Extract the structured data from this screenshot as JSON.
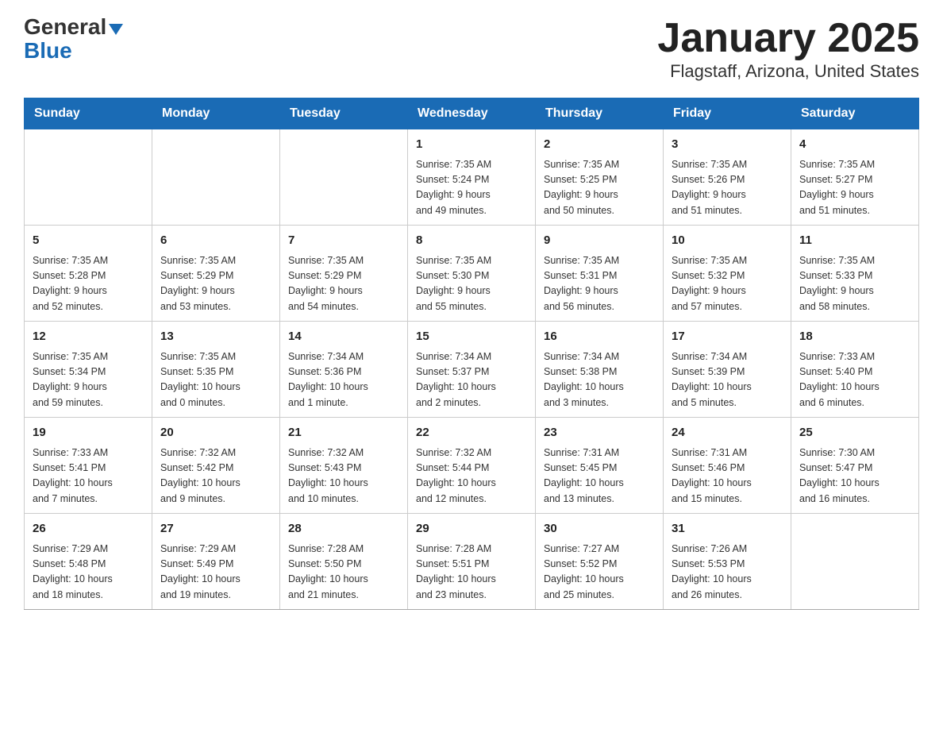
{
  "header": {
    "logo_general": "General",
    "logo_arrow": "▼",
    "logo_blue": "Blue",
    "title": "January 2025",
    "subtitle": "Flagstaff, Arizona, United States"
  },
  "calendar": {
    "days_of_week": [
      "Sunday",
      "Monday",
      "Tuesday",
      "Wednesday",
      "Thursday",
      "Friday",
      "Saturday"
    ],
    "weeks": [
      [
        {
          "day": "",
          "info": ""
        },
        {
          "day": "",
          "info": ""
        },
        {
          "day": "",
          "info": ""
        },
        {
          "day": "1",
          "info": "Sunrise: 7:35 AM\nSunset: 5:24 PM\nDaylight: 9 hours\nand 49 minutes."
        },
        {
          "day": "2",
          "info": "Sunrise: 7:35 AM\nSunset: 5:25 PM\nDaylight: 9 hours\nand 50 minutes."
        },
        {
          "day": "3",
          "info": "Sunrise: 7:35 AM\nSunset: 5:26 PM\nDaylight: 9 hours\nand 51 minutes."
        },
        {
          "day": "4",
          "info": "Sunrise: 7:35 AM\nSunset: 5:27 PM\nDaylight: 9 hours\nand 51 minutes."
        }
      ],
      [
        {
          "day": "5",
          "info": "Sunrise: 7:35 AM\nSunset: 5:28 PM\nDaylight: 9 hours\nand 52 minutes."
        },
        {
          "day": "6",
          "info": "Sunrise: 7:35 AM\nSunset: 5:29 PM\nDaylight: 9 hours\nand 53 minutes."
        },
        {
          "day": "7",
          "info": "Sunrise: 7:35 AM\nSunset: 5:29 PM\nDaylight: 9 hours\nand 54 minutes."
        },
        {
          "day": "8",
          "info": "Sunrise: 7:35 AM\nSunset: 5:30 PM\nDaylight: 9 hours\nand 55 minutes."
        },
        {
          "day": "9",
          "info": "Sunrise: 7:35 AM\nSunset: 5:31 PM\nDaylight: 9 hours\nand 56 minutes."
        },
        {
          "day": "10",
          "info": "Sunrise: 7:35 AM\nSunset: 5:32 PM\nDaylight: 9 hours\nand 57 minutes."
        },
        {
          "day": "11",
          "info": "Sunrise: 7:35 AM\nSunset: 5:33 PM\nDaylight: 9 hours\nand 58 minutes."
        }
      ],
      [
        {
          "day": "12",
          "info": "Sunrise: 7:35 AM\nSunset: 5:34 PM\nDaylight: 9 hours\nand 59 minutes."
        },
        {
          "day": "13",
          "info": "Sunrise: 7:35 AM\nSunset: 5:35 PM\nDaylight: 10 hours\nand 0 minutes."
        },
        {
          "day": "14",
          "info": "Sunrise: 7:34 AM\nSunset: 5:36 PM\nDaylight: 10 hours\nand 1 minute."
        },
        {
          "day": "15",
          "info": "Sunrise: 7:34 AM\nSunset: 5:37 PM\nDaylight: 10 hours\nand 2 minutes."
        },
        {
          "day": "16",
          "info": "Sunrise: 7:34 AM\nSunset: 5:38 PM\nDaylight: 10 hours\nand 3 minutes."
        },
        {
          "day": "17",
          "info": "Sunrise: 7:34 AM\nSunset: 5:39 PM\nDaylight: 10 hours\nand 5 minutes."
        },
        {
          "day": "18",
          "info": "Sunrise: 7:33 AM\nSunset: 5:40 PM\nDaylight: 10 hours\nand 6 minutes."
        }
      ],
      [
        {
          "day": "19",
          "info": "Sunrise: 7:33 AM\nSunset: 5:41 PM\nDaylight: 10 hours\nand 7 minutes."
        },
        {
          "day": "20",
          "info": "Sunrise: 7:32 AM\nSunset: 5:42 PM\nDaylight: 10 hours\nand 9 minutes."
        },
        {
          "day": "21",
          "info": "Sunrise: 7:32 AM\nSunset: 5:43 PM\nDaylight: 10 hours\nand 10 minutes."
        },
        {
          "day": "22",
          "info": "Sunrise: 7:32 AM\nSunset: 5:44 PM\nDaylight: 10 hours\nand 12 minutes."
        },
        {
          "day": "23",
          "info": "Sunrise: 7:31 AM\nSunset: 5:45 PM\nDaylight: 10 hours\nand 13 minutes."
        },
        {
          "day": "24",
          "info": "Sunrise: 7:31 AM\nSunset: 5:46 PM\nDaylight: 10 hours\nand 15 minutes."
        },
        {
          "day": "25",
          "info": "Sunrise: 7:30 AM\nSunset: 5:47 PM\nDaylight: 10 hours\nand 16 minutes."
        }
      ],
      [
        {
          "day": "26",
          "info": "Sunrise: 7:29 AM\nSunset: 5:48 PM\nDaylight: 10 hours\nand 18 minutes."
        },
        {
          "day": "27",
          "info": "Sunrise: 7:29 AM\nSunset: 5:49 PM\nDaylight: 10 hours\nand 19 minutes."
        },
        {
          "day": "28",
          "info": "Sunrise: 7:28 AM\nSunset: 5:50 PM\nDaylight: 10 hours\nand 21 minutes."
        },
        {
          "day": "29",
          "info": "Sunrise: 7:28 AM\nSunset: 5:51 PM\nDaylight: 10 hours\nand 23 minutes."
        },
        {
          "day": "30",
          "info": "Sunrise: 7:27 AM\nSunset: 5:52 PM\nDaylight: 10 hours\nand 25 minutes."
        },
        {
          "day": "31",
          "info": "Sunrise: 7:26 AM\nSunset: 5:53 PM\nDaylight: 10 hours\nand 26 minutes."
        },
        {
          "day": "",
          "info": ""
        }
      ]
    ]
  }
}
